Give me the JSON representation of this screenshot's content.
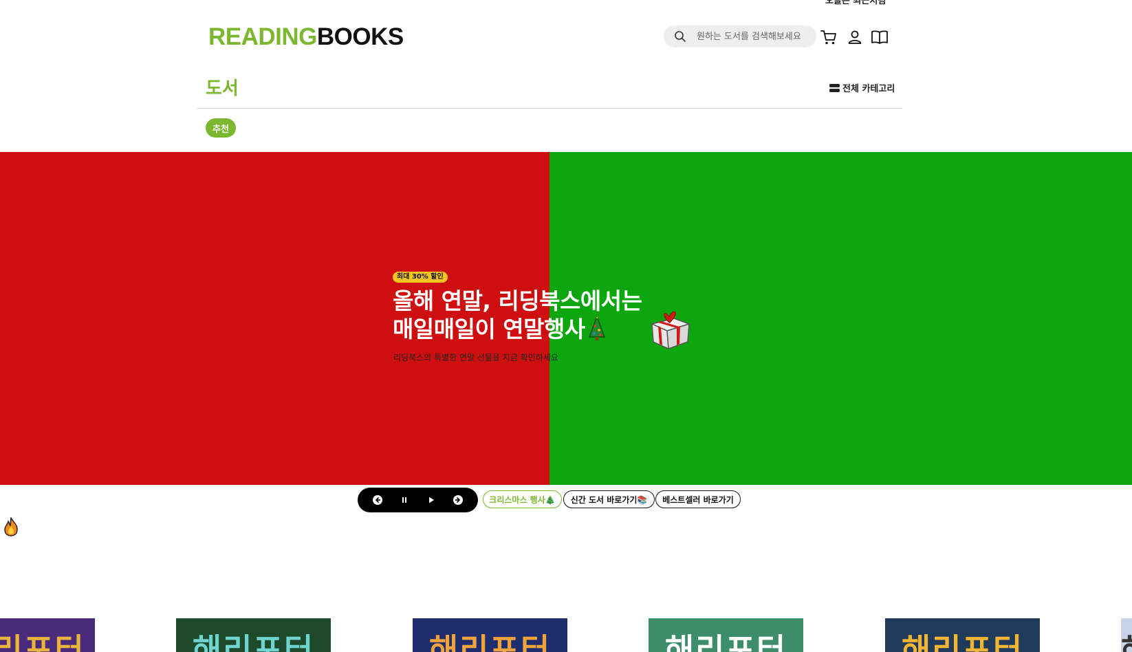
{
  "header": {
    "top_link": "오늘은 최근처럼",
    "logo": {
      "part1": "READING",
      "part2": "BOOKS"
    },
    "search": {
      "placeholder": "원하는 도서를 검색해보세요"
    },
    "icons": [
      "search-icon",
      "cart-icon",
      "user-icon",
      "book-open-icon"
    ]
  },
  "nav": {
    "section_title": "도서",
    "all_categories": "전체 카테고리",
    "tabs": [
      {
        "label": "추천",
        "active": true
      }
    ]
  },
  "banner": {
    "left_color": "#cf0f0f",
    "right_color": "#0ca70f",
    "badge": "최대 30% 할인",
    "headline_line1": "올해 연말, 리딩북스에서는",
    "headline_line2": "매일매일이 연말행사",
    "subtext": "리딩북스의 특별한 연말 선물을 지금 확인하세요"
  },
  "slider": {
    "controls": [
      "prev-icon",
      "pause-icon",
      "play-icon",
      "next-icon"
    ],
    "chips": [
      {
        "label": "크리스마스 행사🎄",
        "active": true
      },
      {
        "label": "신간 도서 바로가기📚",
        "active": false
      },
      {
        "label": "베스트셀러 바로가기",
        "active": false
      }
    ]
  },
  "theme": {
    "accent": "#7cb82f",
    "badge": "#f4c51e"
  },
  "book_list": {
    "items": [
      {
        "cover_text": "해리포터",
        "bg": "#4a2a7a",
        "fg": "#e8b43c"
      },
      {
        "cover_text": "해리포터",
        "bg": "#1d4a2a",
        "fg": "#6fd3d0"
      },
      {
        "cover_text": "해리포터",
        "bg": "#1d2d6e",
        "fg": "#f0a23c"
      },
      {
        "cover_text": "해리포터",
        "bg": "#3d8d6b",
        "fg": "#ffffff"
      },
      {
        "cover_text": "해리포터",
        "bg": "#1f3a5a",
        "fg": "#f2b533"
      },
      {
        "cover_text": "해리포터",
        "bg": "#c8d3e8",
        "fg": "#333333"
      }
    ]
  }
}
